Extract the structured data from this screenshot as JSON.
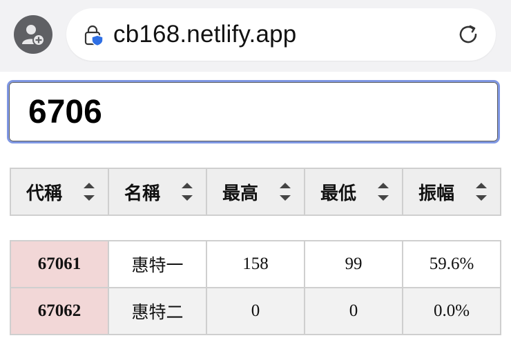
{
  "browser": {
    "url": "cb168.netlify.app",
    "icons": [
      "profile-add-icon",
      "lock-shield-icon",
      "reload-icon"
    ]
  },
  "search": {
    "value": "6706"
  },
  "table": {
    "columns": [
      "代稱",
      "名稱",
      "最高",
      "最低",
      "振幅"
    ],
    "rows": [
      {
        "code": "67061",
        "name": "惠特一",
        "high": "158",
        "low": "99",
        "amplitude": "59.6%"
      },
      {
        "code": "67062",
        "name": "惠特二",
        "high": "0",
        "low": "0",
        "amplitude": "0.0%"
      }
    ]
  },
  "colors": {
    "code_cell_bg": "#f2d7d7",
    "input_border": "#7f97e3",
    "header_bg": "#eeeeee",
    "border": "#cfcfcf"
  }
}
